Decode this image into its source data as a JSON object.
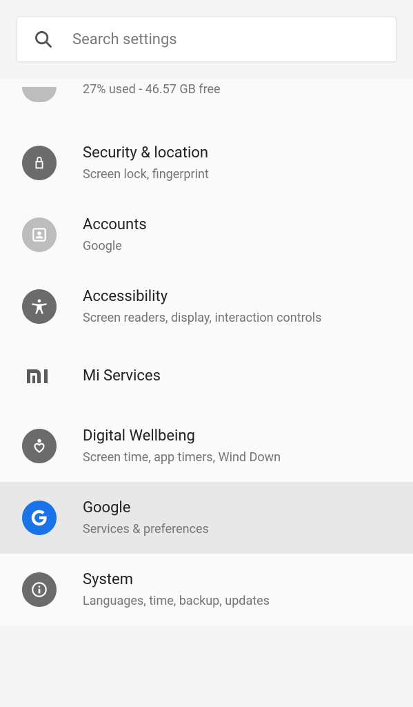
{
  "search": {
    "placeholder": "Search settings"
  },
  "items": {
    "storage": {
      "subtitle": "27% used - 46.57 GB free"
    },
    "security": {
      "title": "Security & location",
      "subtitle": "Screen lock, fingerprint"
    },
    "accounts": {
      "title": "Accounts",
      "subtitle": "Google"
    },
    "accessibility": {
      "title": "Accessibility",
      "subtitle": "Screen readers, display, interaction controls"
    },
    "miservices": {
      "title": "Mi Services"
    },
    "wellbeing": {
      "title": "Digital Wellbeing",
      "subtitle": "Screen time, app timers, Wind Down"
    },
    "google": {
      "title": "Google",
      "subtitle": "Services & preferences"
    },
    "system": {
      "title": "System",
      "subtitle": "Languages, time, backup, updates"
    }
  }
}
